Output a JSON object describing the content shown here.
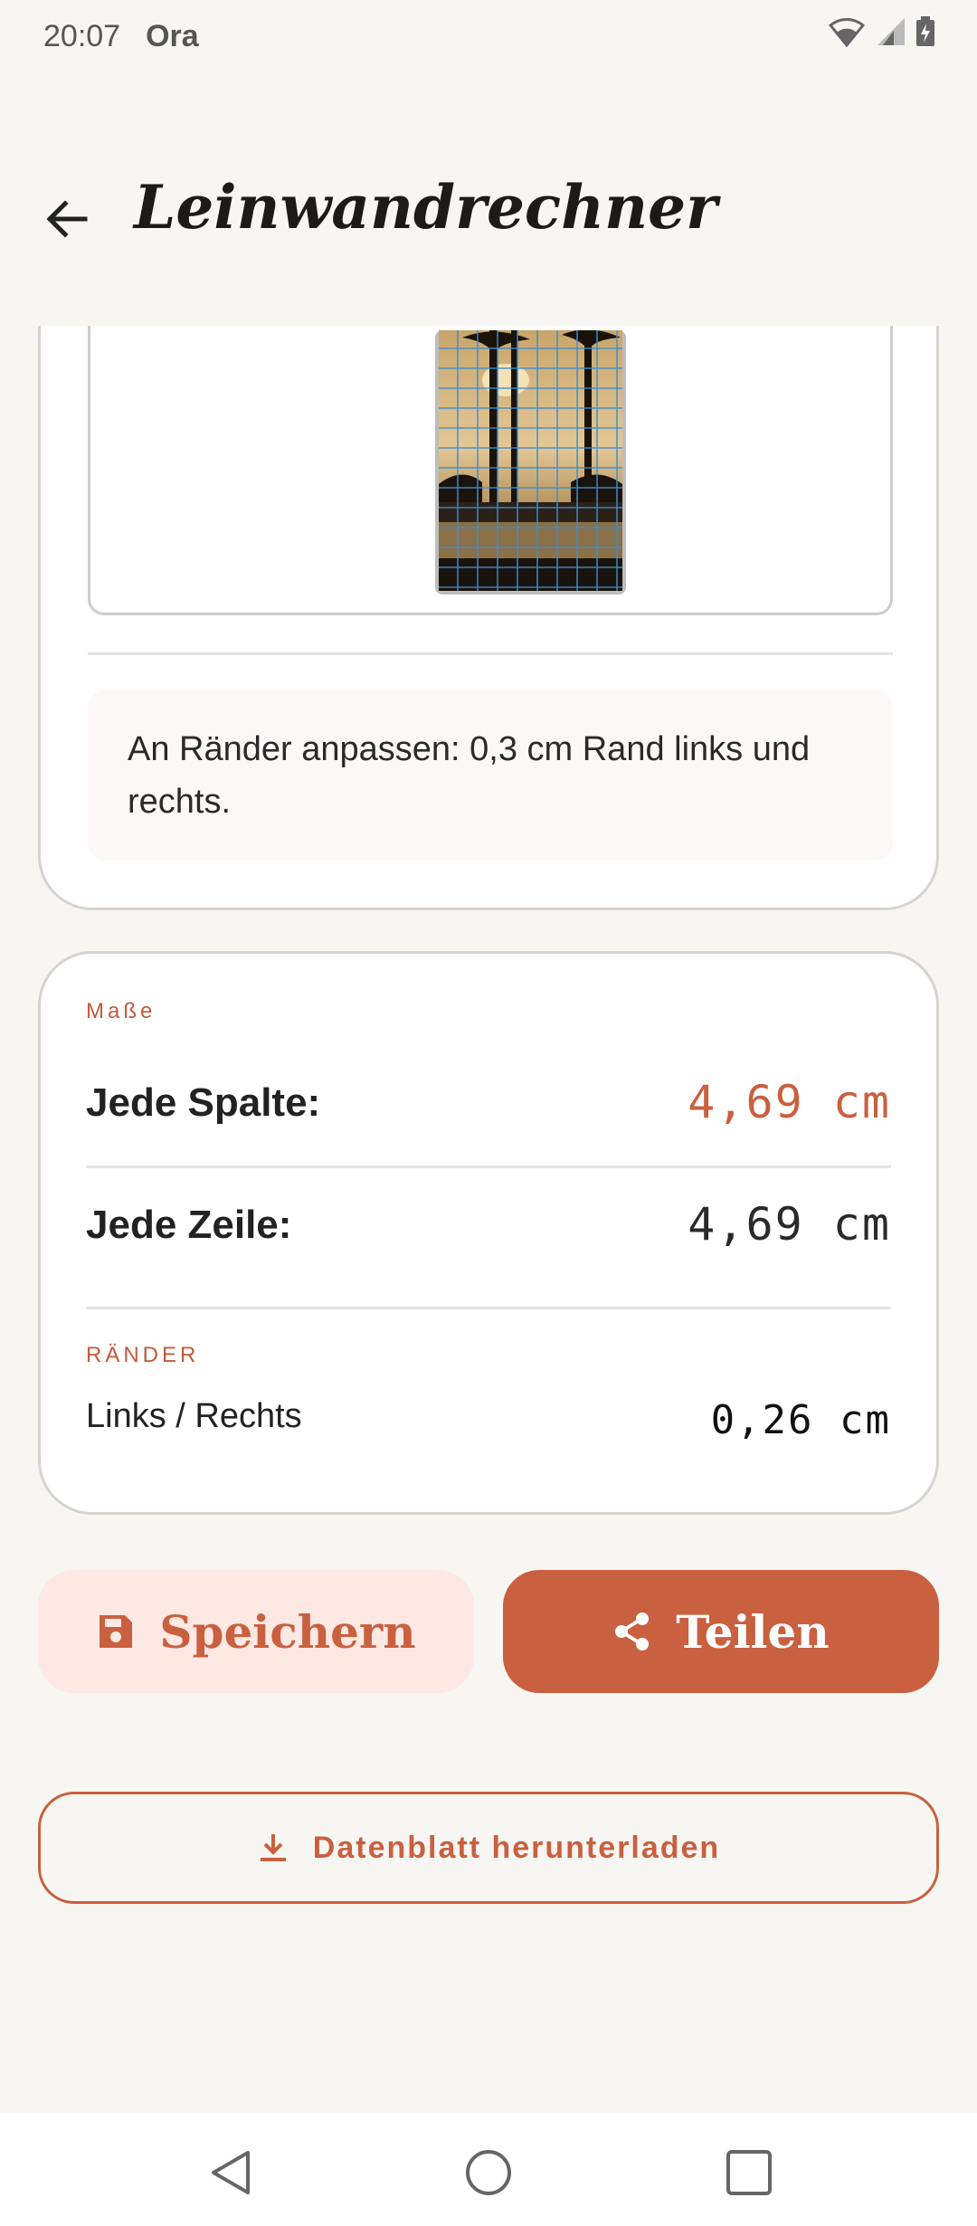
{
  "status": {
    "time": "20:07",
    "carrier": "Ora"
  },
  "app_bar": {
    "title": "Leinwandrechner"
  },
  "preview": {
    "fit_info": "An Ränder anpassen: 0,3 cm Rand links und rechts."
  },
  "measurements": {
    "section_title": "Maße",
    "column_label": "Jede Spalte:",
    "column_value": "4,69 cm",
    "row_label": "Jede Zeile:",
    "row_value": "4,69 cm",
    "margins_title": "RÄNDER",
    "margins_label": "Links / Rechts",
    "margins_value": "0,26 cm"
  },
  "actions": {
    "save_label": "Speichern",
    "share_label": "Teilen",
    "download_label": "Datenblatt herunterladen"
  },
  "colors": {
    "accent": "#c9603f",
    "background": "#f8f6f3",
    "save_bg": "#fde8e3"
  }
}
